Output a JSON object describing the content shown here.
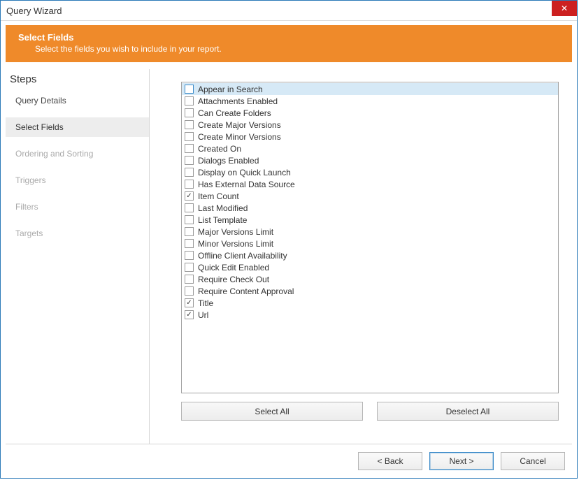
{
  "window": {
    "title": "Query Wizard"
  },
  "banner": {
    "title": "Select Fields",
    "subtitle": "Select the fields you wish to include in your report."
  },
  "steps": {
    "heading": "Steps",
    "items": [
      {
        "label": "Query Details",
        "state": "done"
      },
      {
        "label": "Select Fields",
        "state": "current"
      },
      {
        "label": "Ordering and Sorting",
        "state": "future"
      },
      {
        "label": "Triggers",
        "state": "future"
      },
      {
        "label": "Filters",
        "state": "future"
      },
      {
        "label": "Targets",
        "state": "future"
      }
    ]
  },
  "fields": {
    "selected_index": 0,
    "items": [
      {
        "label": "Appear in Search",
        "checked": false
      },
      {
        "label": "Attachments Enabled",
        "checked": false
      },
      {
        "label": "Can Create Folders",
        "checked": false
      },
      {
        "label": "Create Major Versions",
        "checked": false
      },
      {
        "label": "Create Minor Versions",
        "checked": false
      },
      {
        "label": "Created On",
        "checked": false
      },
      {
        "label": "Dialogs Enabled",
        "checked": false
      },
      {
        "label": "Display on Quick Launch",
        "checked": false
      },
      {
        "label": "Has External Data Source",
        "checked": false
      },
      {
        "label": "Item Count",
        "checked": true
      },
      {
        "label": "Last Modified",
        "checked": false
      },
      {
        "label": "List Template",
        "checked": false
      },
      {
        "label": "Major Versions Limit",
        "checked": false
      },
      {
        "label": "Minor Versions Limit",
        "checked": false
      },
      {
        "label": "Offline Client Availability",
        "checked": false
      },
      {
        "label": "Quick Edit Enabled",
        "checked": false
      },
      {
        "label": "Require Check Out",
        "checked": false
      },
      {
        "label": "Require Content Approval",
        "checked": false
      },
      {
        "label": "Title",
        "checked": true
      },
      {
        "label": "Url",
        "checked": true
      }
    ]
  },
  "buttons": {
    "select_all": "Select All",
    "deselect_all": "Deselect All",
    "back": "< Back",
    "next": "Next >",
    "cancel": "Cancel"
  }
}
